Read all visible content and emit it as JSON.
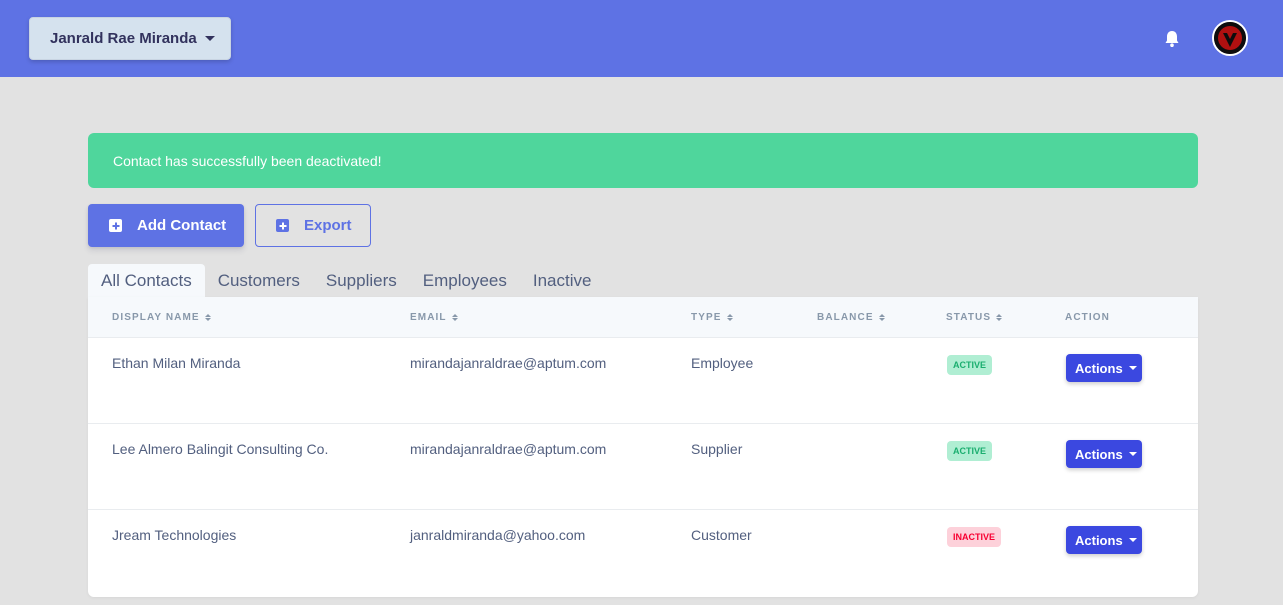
{
  "header": {
    "user_name": "Janrald Rae Miranda",
    "bell_icon": "bell-icon",
    "avatar_icon": "avatar"
  },
  "alert": {
    "message": "Contact has successfully been deactivated!",
    "color": "#4fd69c"
  },
  "toolbar": {
    "add_label": "Add Contact",
    "export_label": "Export"
  },
  "tabs": [
    {
      "label": "All Contacts",
      "active": true
    },
    {
      "label": "Customers"
    },
    {
      "label": "Suppliers"
    },
    {
      "label": "Employees"
    },
    {
      "label": "Inactive"
    }
  ],
  "table": {
    "columns": [
      "DISPLAY NAME",
      "EMAIL",
      "TYPE",
      "BALANCE",
      "STATUS",
      "ACTION"
    ],
    "rows": [
      {
        "name": "Ethan Milan Miranda",
        "email": "mirandajanraldrae@aptum.com",
        "type": "Employee",
        "balance": "",
        "status": "ACTIVE",
        "action": "Actions"
      },
      {
        "name": "Lee Almero Balingit Consulting Co.",
        "email": "mirandajanraldrae@aptum.com",
        "type": "Supplier",
        "balance": "",
        "status": "ACTIVE",
        "action": "Actions"
      },
      {
        "name": "Jream Technologies",
        "email": "janraldmiranda@yahoo.com",
        "type": "Customer",
        "balance": "",
        "status": "INACTIVE",
        "action": "Actions"
      }
    ]
  },
  "colors": {
    "accent": "#5e72e4",
    "action_button": "#3b48e0",
    "status_active": "#1aae6f",
    "status_inactive": "#f80031"
  }
}
